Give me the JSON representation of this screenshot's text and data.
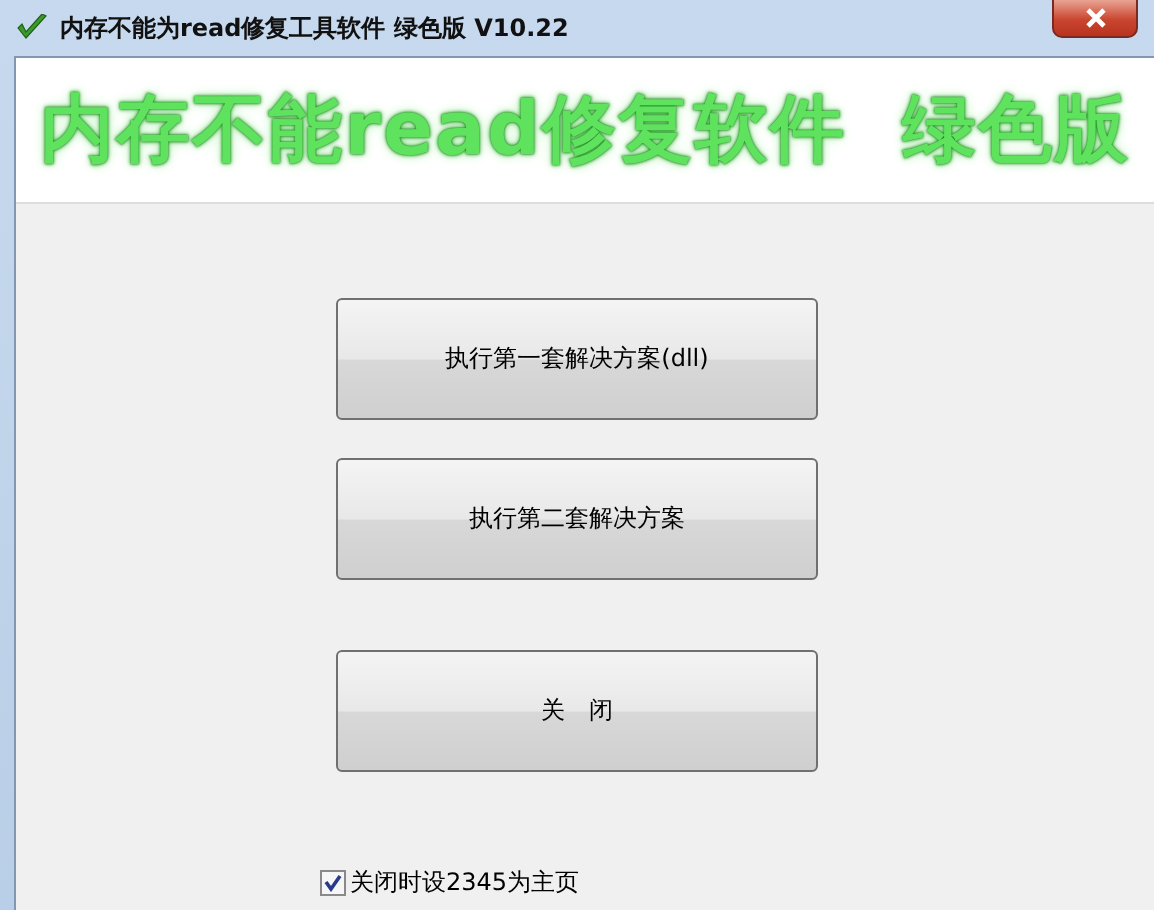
{
  "window": {
    "title": "内存不能为read修复工具软件 绿色版 V10.22"
  },
  "banner": {
    "text": "内存不能read修复软件  绿色版"
  },
  "buttons": [
    {
      "label": "执行第一套解决方案(dll)"
    },
    {
      "label": "执行第二套解决方案"
    },
    {
      "label": "关　闭"
    }
  ],
  "options": [
    {
      "label": "关闭时设2345为主页",
      "checked": true
    }
  ]
}
